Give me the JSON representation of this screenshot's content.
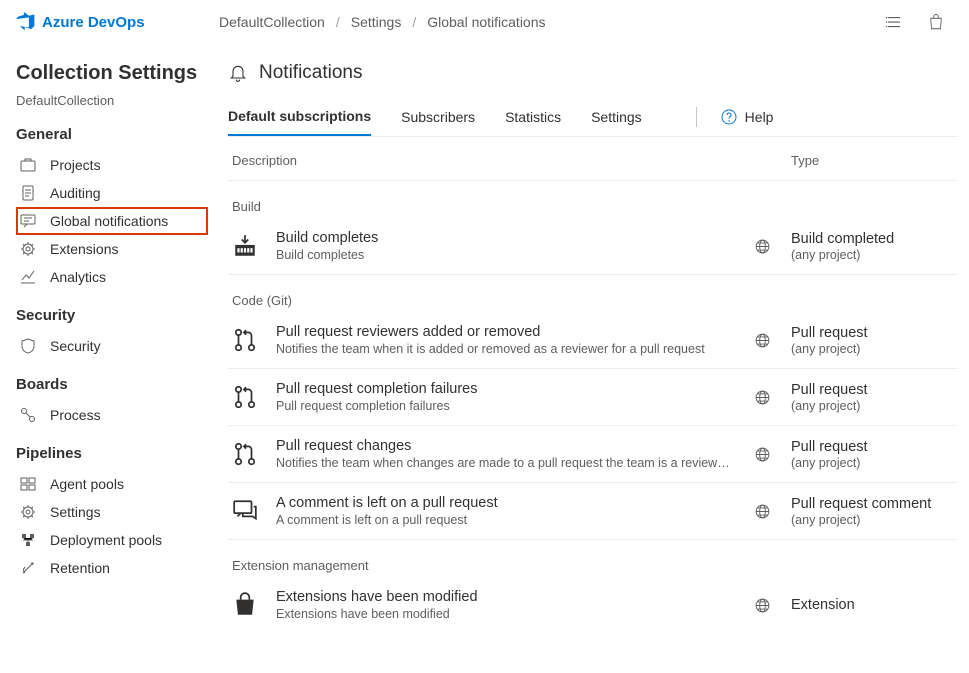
{
  "topbar": {
    "product": "Azure DevOps",
    "crumbs": [
      "DefaultCollection",
      "Settings",
      "Global notifications"
    ]
  },
  "sidebar": {
    "title": "Collection Settings",
    "subtitle": "DefaultCollection",
    "sections": {
      "general": {
        "head": "General",
        "items": [
          "Projects",
          "Auditing",
          "Global notifications",
          "Extensions",
          "Analytics"
        ]
      },
      "security": {
        "head": "Security",
        "items": [
          "Security"
        ]
      },
      "boards": {
        "head": "Boards",
        "items": [
          "Process"
        ]
      },
      "pipelines": {
        "head": "Pipelines",
        "items": [
          "Agent pools",
          "Settings",
          "Deployment pools",
          "Retention"
        ]
      }
    }
  },
  "page": {
    "title": "Notifications"
  },
  "tabs": [
    "Default subscriptions",
    "Subscribers",
    "Statistics",
    "Settings"
  ],
  "help": "Help",
  "cols": {
    "desc": "Description",
    "type": "Type"
  },
  "groups": [
    {
      "label": "Build",
      "rows": [
        {
          "title": "Build completes",
          "desc": "Build completes",
          "type": "Build completed",
          "scope": "(any project)",
          "icon": "build"
        }
      ]
    },
    {
      "label": "Code (Git)",
      "rows": [
        {
          "title": "Pull request reviewers added or removed",
          "desc": "Notifies the team when it is added or removed as a reviewer for a pull request",
          "type": "Pull request",
          "scope": "(any project)",
          "icon": "pr"
        },
        {
          "title": "Pull request completion failures",
          "desc": "Pull request completion failures",
          "type": "Pull request",
          "scope": "(any project)",
          "icon": "pr"
        },
        {
          "title": "Pull request changes",
          "desc": "Notifies the team when changes are made to a pull request the team is a reviewer for",
          "type": "Pull request",
          "scope": "(any project)",
          "icon": "pr"
        },
        {
          "title": "A comment is left on a pull request",
          "desc": "A comment is left on a pull request",
          "type": "Pull request comment",
          "scope": "(any project)",
          "icon": "comment"
        }
      ]
    },
    {
      "label": "Extension management",
      "rows": [
        {
          "title": "Extensions have been modified",
          "desc": "Extensions have been modified",
          "type": "Extension",
          "scope": "",
          "icon": "bag"
        }
      ]
    }
  ]
}
